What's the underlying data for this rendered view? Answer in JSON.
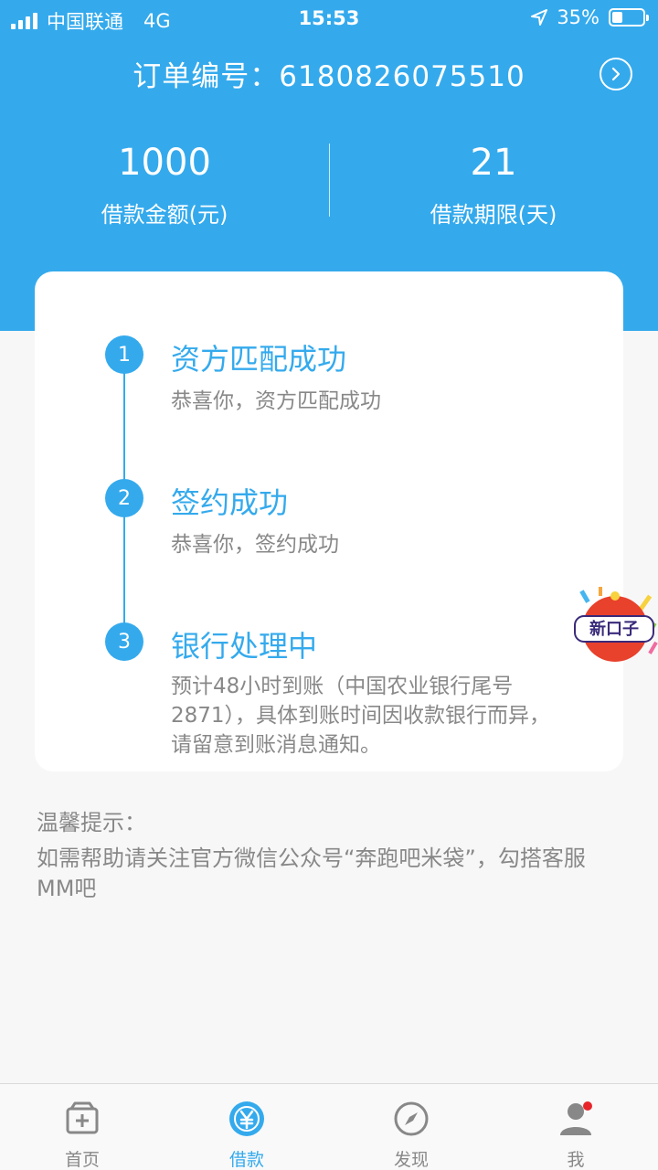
{
  "status_bar": {
    "carrier": "中国联通",
    "network": "4G",
    "time": "15:53",
    "battery": "35%",
    "battery_level": 0.35
  },
  "order": {
    "label": "订单编号：",
    "number": "6180826075510"
  },
  "loan": {
    "amount_value": "1000",
    "amount_label": "借款金额(元)",
    "term_value": "21",
    "term_label": "借款期限(天)"
  },
  "steps": [
    {
      "num": "1",
      "title": "资方匹配成功",
      "desc": "恭喜你，资方匹配成功"
    },
    {
      "num": "2",
      "title": "签约成功",
      "desc": "恭喜你，签约成功"
    },
    {
      "num": "3",
      "title": "银行处理中",
      "desc": "预计48小时到账（中国农业银行尾号2871），具体到账时间因收款银行而异，请留意到账消息通知。"
    }
  ],
  "tips": {
    "title": "温馨提示：",
    "text": "如需帮助请关注官方微信公众号“奔跑吧米袋”，勾搭客服MM吧"
  },
  "promo_badge": "新口子",
  "tabs": [
    {
      "label": "首页",
      "icon": "home-box-icon",
      "active": false
    },
    {
      "label": "借款",
      "icon": "yuan-icon",
      "active": true
    },
    {
      "label": "发现",
      "icon": "compass-icon",
      "active": false
    },
    {
      "label": "我",
      "icon": "user-icon",
      "active": false,
      "dot": true
    }
  ],
  "colors": {
    "primary": "#34aaed",
    "text_gray": "#888888",
    "badge_red": "#e8412c"
  }
}
